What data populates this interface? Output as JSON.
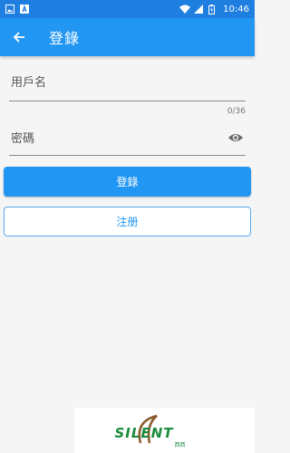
{
  "status_bar": {
    "time": "10:46"
  },
  "app_bar": {
    "title": "登錄"
  },
  "form": {
    "username_label": "用戶名",
    "counter": "0/36",
    "password_label": "密碼"
  },
  "buttons": {
    "login_label": "登錄",
    "register_label": "注册"
  },
  "watermark": {
    "text": "SILENT",
    "sub": "西西"
  },
  "colors": {
    "primary": "#2196f3",
    "status": "#1f7fe0",
    "background": "#f5f5f5"
  }
}
